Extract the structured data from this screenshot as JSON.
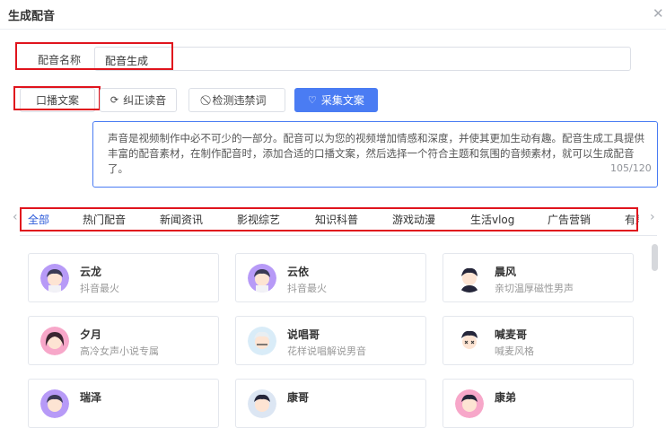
{
  "dialog": {
    "title": "生成配音",
    "close_icon": "close-icon"
  },
  "name_field": {
    "label": "配音名称",
    "value": "配音生成"
  },
  "toolbar": {
    "script_btn": "口播文案",
    "correct_btn": "纠正读音",
    "detect_btn": "检测违禁词",
    "collect_btn": "采集文案"
  },
  "script": {
    "text": "声音是视频制作中必不可少的一部分。配音可以为您的视频增加情感和深度，并使其更加生动有趣。配音生成工具提供丰富的配音素材，在制作配音时，添加合适的口播文案，然后选择一个符合主题和氛围的音频素材，就可以生成配音了。",
    "counter": "105/120"
  },
  "tabs": [
    "全部",
    "热门配音",
    "新闻资讯",
    "影视综艺",
    "知识科普",
    "游戏动漫",
    "生活vlog",
    "广告营销",
    "有声"
  ],
  "voices": [
    {
      "name": "云龙",
      "desc": "抖音最火"
    },
    {
      "name": "云依",
      "desc": "抖音最火"
    },
    {
      "name": "晨风",
      "desc": "亲切温厚磁性男声"
    },
    {
      "name": "夕月",
      "desc": "高冷女声小说专属"
    },
    {
      "name": "说唱哥",
      "desc": "花样说唱解说男音"
    },
    {
      "name": "喊麦哥",
      "desc": "喊麦风格"
    },
    {
      "name": "瑞泽",
      "desc": ""
    },
    {
      "name": "康哥",
      "desc": ""
    },
    {
      "name": "康弟",
      "desc": ""
    }
  ],
  "colors": {
    "accent": "#4a7cf3",
    "highlight": "#e0141d"
  }
}
